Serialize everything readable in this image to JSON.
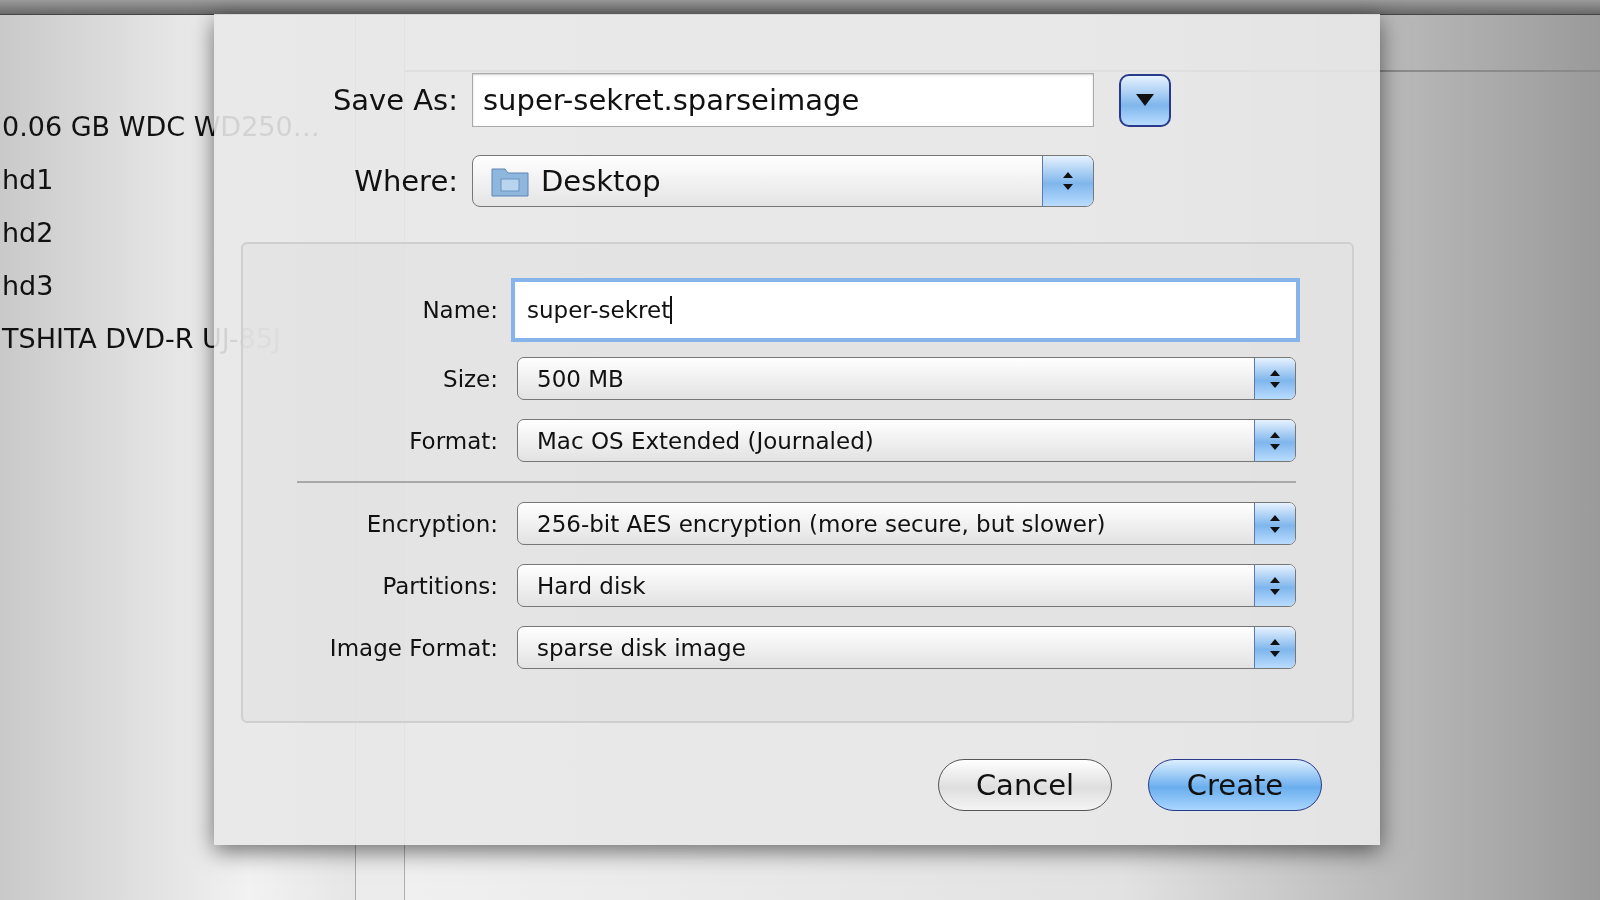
{
  "sidebar": {
    "items": [
      {
        "label": "0.06 GB WDC WD250…",
        "selected": false
      },
      {
        "label": "hd1",
        "selected": false
      },
      {
        "label": "hd2",
        "selected": false
      },
      {
        "label": "hd3",
        "selected": false
      },
      {
        "label": "TSHITA DVD-R UJ-85J",
        "selected": false
      }
    ]
  },
  "sheet": {
    "save_as": {
      "label": "Save As:",
      "value": "super-sekret.sparseimage"
    },
    "where": {
      "label": "Where:",
      "value": "Desktop"
    },
    "options": [
      {
        "kind": "text",
        "label": "Name:",
        "value": "super-sekret",
        "focused": true
      },
      {
        "kind": "popup",
        "label": "Size:",
        "value": "500 MB"
      },
      {
        "kind": "popup",
        "label": "Format:",
        "value": "Mac OS Extended (Journaled)"
      },
      {
        "kind": "separator"
      },
      {
        "kind": "popup",
        "label": "Encryption:",
        "value": "256-bit AES encryption (more secure, but slower)"
      },
      {
        "kind": "popup",
        "label": "Partitions:",
        "value": "Hard disk"
      },
      {
        "kind": "popup",
        "label": "Image Format:",
        "value": "sparse disk image"
      }
    ],
    "buttons": [
      {
        "label": "Cancel",
        "default": false
      },
      {
        "label": "Create",
        "default": true
      }
    ]
  }
}
